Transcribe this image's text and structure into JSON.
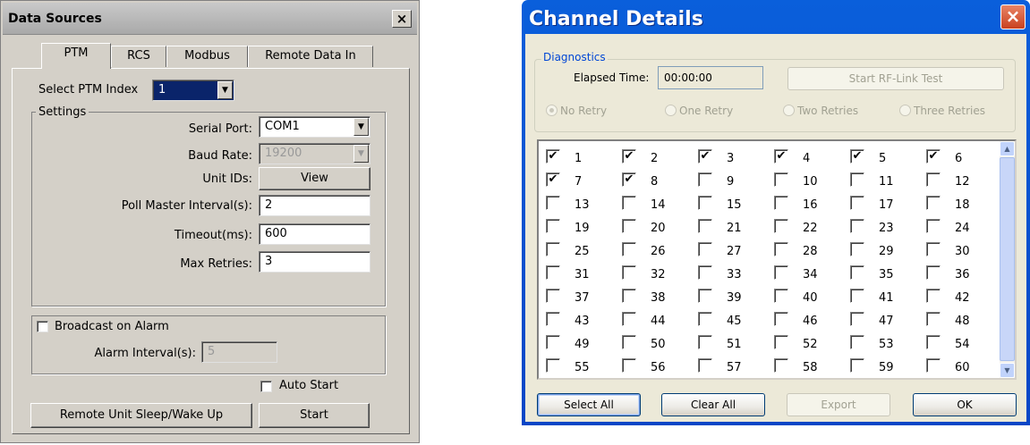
{
  "data_sources": {
    "title": "Data Sources",
    "close_glyph": "×",
    "tabs": [
      {
        "label": "PTM",
        "active": true
      },
      {
        "label": "RCS",
        "active": false
      },
      {
        "label": "Modbus",
        "active": false
      },
      {
        "label": "Remote Data In",
        "active": false
      }
    ],
    "select_ptm_index_label": "Select PTM Index",
    "select_ptm_index_value": "1",
    "settings_label": "Settings",
    "serial_port_label": "Serial Port:",
    "serial_port_value": "COM1",
    "baud_rate_label": "Baud Rate:",
    "baud_rate_value": "19200",
    "unit_ids_label": "Unit IDs:",
    "view_button": "View",
    "poll_master_label": "Poll Master Interval(s):",
    "poll_master_value": "2",
    "timeout_label": "Timeout(ms):",
    "timeout_value": "600",
    "max_retries_label": "Max Retries:",
    "max_retries_value": "3",
    "broadcast_label": "Broadcast on Alarm",
    "broadcast_checked": false,
    "alarm_interval_label": "Alarm Interval(s):",
    "alarm_interval_value": "5",
    "auto_start_label": "Auto Start",
    "auto_start_checked": false,
    "sleep_wake_button": "Remote Unit Sleep/Wake Up",
    "start_button": "Start"
  },
  "channel_details": {
    "title": "Channel Details",
    "close_glyph": "×",
    "diagnostics_label": "Diagnostics",
    "elapsed_time_label": "Elapsed Time:",
    "elapsed_time_value": "00:00:00",
    "rf_test_button": "Start RF-Link Test",
    "retry_options": [
      {
        "label": "No Retry",
        "selected": true
      },
      {
        "label": "One Retry",
        "selected": false
      },
      {
        "label": "Two Retries",
        "selected": false
      },
      {
        "label": "Three Retries",
        "selected": false
      }
    ],
    "channels": [
      {
        "n": "1",
        "checked": true
      },
      {
        "n": "2",
        "checked": true
      },
      {
        "n": "3",
        "checked": true
      },
      {
        "n": "4",
        "checked": true
      },
      {
        "n": "5",
        "checked": true
      },
      {
        "n": "6",
        "checked": true
      },
      {
        "n": "7",
        "checked": true
      },
      {
        "n": "8",
        "checked": true
      },
      {
        "n": "9",
        "checked": false
      },
      {
        "n": "10",
        "checked": false
      },
      {
        "n": "11",
        "checked": false
      },
      {
        "n": "12",
        "checked": false
      },
      {
        "n": "13",
        "checked": false
      },
      {
        "n": "14",
        "checked": false
      },
      {
        "n": "15",
        "checked": false
      },
      {
        "n": "16",
        "checked": false
      },
      {
        "n": "17",
        "checked": false
      },
      {
        "n": "18",
        "checked": false
      },
      {
        "n": "19",
        "checked": false
      },
      {
        "n": "20",
        "checked": false
      },
      {
        "n": "21",
        "checked": false
      },
      {
        "n": "22",
        "checked": false
      },
      {
        "n": "23",
        "checked": false
      },
      {
        "n": "24",
        "checked": false
      },
      {
        "n": "25",
        "checked": false
      },
      {
        "n": "26",
        "checked": false
      },
      {
        "n": "27",
        "checked": false
      },
      {
        "n": "28",
        "checked": false
      },
      {
        "n": "29",
        "checked": false
      },
      {
        "n": "30",
        "checked": false
      },
      {
        "n": "31",
        "checked": false
      },
      {
        "n": "32",
        "checked": false
      },
      {
        "n": "33",
        "checked": false
      },
      {
        "n": "34",
        "checked": false
      },
      {
        "n": "35",
        "checked": false
      },
      {
        "n": "36",
        "checked": false
      },
      {
        "n": "37",
        "checked": false
      },
      {
        "n": "38",
        "checked": false
      },
      {
        "n": "39",
        "checked": false
      },
      {
        "n": "40",
        "checked": false
      },
      {
        "n": "41",
        "checked": false
      },
      {
        "n": "42",
        "checked": false
      },
      {
        "n": "43",
        "checked": false
      },
      {
        "n": "44",
        "checked": false
      },
      {
        "n": "45",
        "checked": false
      },
      {
        "n": "46",
        "checked": false
      },
      {
        "n": "47",
        "checked": false
      },
      {
        "n": "48",
        "checked": false
      },
      {
        "n": "49",
        "checked": false
      },
      {
        "n": "50",
        "checked": false
      },
      {
        "n": "51",
        "checked": false
      },
      {
        "n": "52",
        "checked": false
      },
      {
        "n": "53",
        "checked": false
      },
      {
        "n": "54",
        "checked": false
      },
      {
        "n": "55",
        "checked": false
      },
      {
        "n": "56",
        "checked": false
      },
      {
        "n": "57",
        "checked": false
      },
      {
        "n": "58",
        "checked": false
      },
      {
        "n": "59",
        "checked": false
      },
      {
        "n": "60",
        "checked": false
      }
    ],
    "select_all_button": "Select All",
    "clear_all_button": "Clear All",
    "export_button": "Export",
    "ok_button": "OK"
  }
}
